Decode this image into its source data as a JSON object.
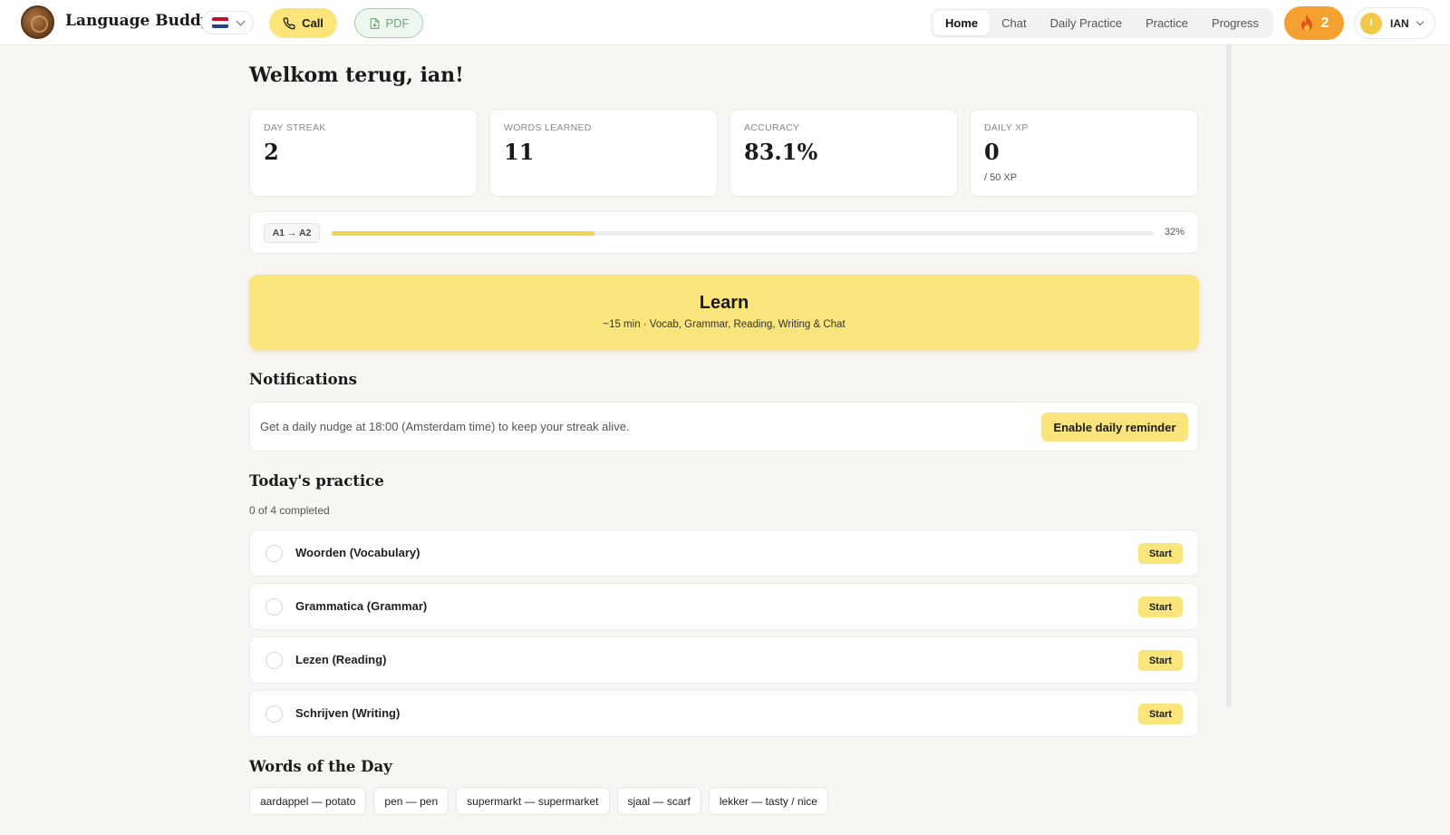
{
  "header": {
    "app_title": "Language Buddy",
    "call_label": "Call",
    "pdf_label": "PDF",
    "nav": [
      {
        "label": "Home",
        "active": true
      },
      {
        "label": "Chat"
      },
      {
        "label": "Daily Practice"
      },
      {
        "label": "Practice"
      },
      {
        "label": "Progress"
      }
    ],
    "streak_count": "2",
    "user_initial": "I",
    "user_name": "IAN",
    "flag_colors": [
      "#c8102e",
      "#ffffff",
      "#21468b"
    ]
  },
  "greeting": "Welkom terug, ian!",
  "stats": [
    {
      "label": "DAY STREAK",
      "value": "2",
      "sub": ""
    },
    {
      "label": "WORDS LEARNED",
      "value": "11",
      "sub": ""
    },
    {
      "label": "ACCURACY",
      "value": "83.1%",
      "sub": ""
    },
    {
      "label": "DAILY XP",
      "value": "0",
      "sub": "/ 50 XP"
    }
  ],
  "level": {
    "badge": "A1 → A2",
    "progress": 0.32,
    "percent_label": "32%"
  },
  "learn": {
    "title": "Learn",
    "subtitle": "~15 min · Vocab, Grammar, Reading, Writing & Chat"
  },
  "notifications": {
    "title": "Notifications",
    "text": "Get a daily nudge at 18:00 (Amsterdam time) to keep your streak alive.",
    "button": "Enable daily reminder"
  },
  "practice": {
    "title": "Today's practice",
    "completed": "0 of 4 completed",
    "start_label": "Start",
    "tasks": [
      {
        "label": "Woorden (Vocabulary)"
      },
      {
        "label": "Grammatica (Grammar)"
      },
      {
        "label": "Lezen (Reading)"
      },
      {
        "label": "Schrijven (Writing)"
      }
    ]
  },
  "words_of_day": {
    "title": "Words of the Day",
    "items": [
      "aardappel — potato",
      "pen — pen",
      "supermarkt — supermarket",
      "sjaal — scarf",
      "lekker — tasty / nice"
    ]
  },
  "colors": {
    "accent": "#fae47c",
    "streak": "#f4a132",
    "pdf_green": "#6aa876"
  }
}
